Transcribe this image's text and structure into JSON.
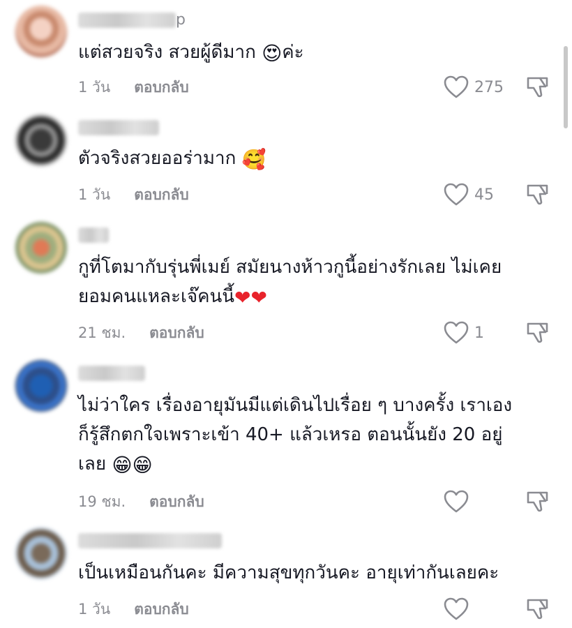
{
  "comments": [
    {
      "username_tail": "p",
      "text": "แต่สวยจริง สวยผู้ดีมาก ",
      "text_suffix": "ค่ะ",
      "emoji": "😍",
      "time": "1 วัน",
      "reply": "ตอบกลับ",
      "likes": "275"
    },
    {
      "text": "ตัวจริงสวยออร่ามาก ",
      "emoji": "🥰",
      "time": "1 วัน",
      "reply": "ตอบกลับ",
      "likes": "45"
    },
    {
      "text_line1": "กูที่โตมากับรุ่นพี่เมย์ สมัยนางห้าวกูนี้อย่างรักเลย ไม่เคย",
      "text_line2": "ยอมคนแหละเจ๊คนนี้",
      "emoji": "❤❤",
      "time": "21 ชม.",
      "reply": "ตอบกลับ",
      "likes": "1"
    },
    {
      "text_line1": "ไม่ว่าใคร เรื่องอายุมันมีแต่เดินไปเรื่อย ๆ บางครั้ง เราเอง",
      "text_line2": "ก็รู้สึกตกใจเพราะเข้า 40+ แล้วเหรอ ตอนนั้นยัง 20 อยู่",
      "text_line3": "เลย ",
      "emoji": "😁😁",
      "time": "19 ชม.",
      "reply": "ตอบกลับ"
    },
    {
      "text": "เป็นเหมือนกันคะ มีความสุขทุกวันคะ อายุเท่ากันเลยคะ",
      "time": "1 วัน",
      "reply": "ตอบกลับ"
    }
  ],
  "icons": {
    "like": "heart-outline-icon",
    "dislike": "thumbs-down-icon"
  },
  "colors": {
    "text": "#161823",
    "meta": "#8a8b91",
    "heart": "#e8232b"
  }
}
